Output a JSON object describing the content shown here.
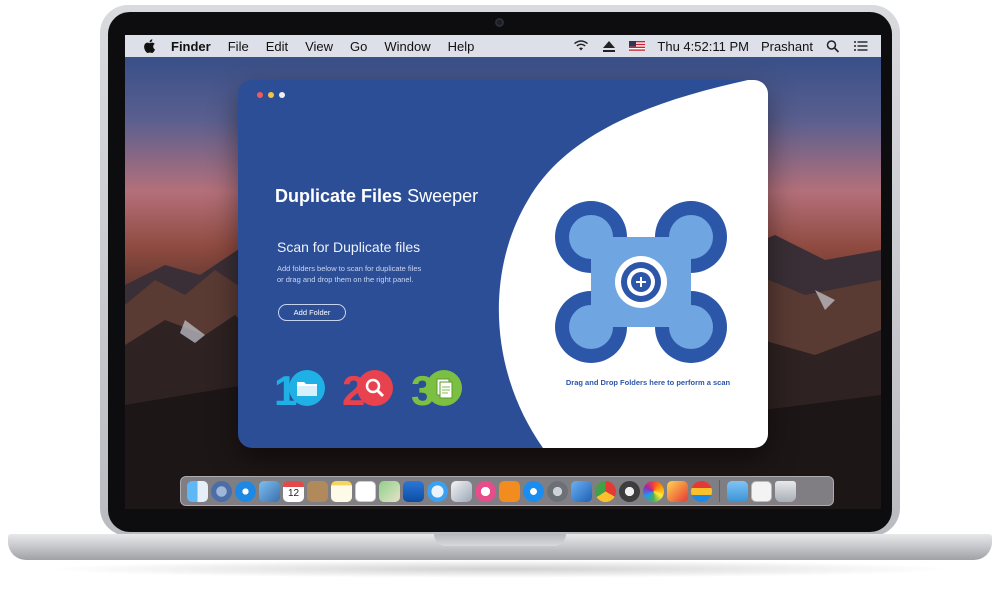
{
  "menubar": {
    "app_name": "Finder",
    "menus": [
      "File",
      "Edit",
      "View",
      "Go",
      "Window",
      "Help"
    ],
    "clock": "Thu 4:52:11 PM",
    "user": "Prashant"
  },
  "app": {
    "title_bold": "Duplicate Files",
    "title_regular": "Sweeper",
    "scan_heading": "Scan for Duplicate files",
    "description": "Add folders below to scan for duplicate files or drag and drop them on the right panel.",
    "add_folder_label": "Add Folder",
    "steps": [
      "1",
      "2",
      "3"
    ],
    "drop_hint": "Drag and Drop Folders here to perform a scan",
    "colors": {
      "panel_blue": "#2c4e96",
      "accent_blue": "#2c56a8",
      "step1": "#1fb1e6",
      "step2": "#e8424f",
      "step3": "#7cc043"
    }
  },
  "dock": {
    "calendar_day": "12",
    "icons": [
      "finder-icon",
      "launchpad-icon",
      "safari-icon",
      "photos-preview-icon",
      "calendar-icon",
      "contacts-icon",
      "notes-icon",
      "reminders-icon",
      "maps-icon",
      "keynote-icon",
      "messages-icon",
      "image-capture-icon",
      "itunes-icon",
      "ibooks-icon",
      "app-store-icon",
      "system-preferences-icon",
      "xcode-icon",
      "chrome-icon",
      "compass-icon",
      "photos-icon",
      "crossover-icon",
      "layers-icon",
      "folder-icon",
      "preview-icon",
      "trash-icon"
    ]
  }
}
